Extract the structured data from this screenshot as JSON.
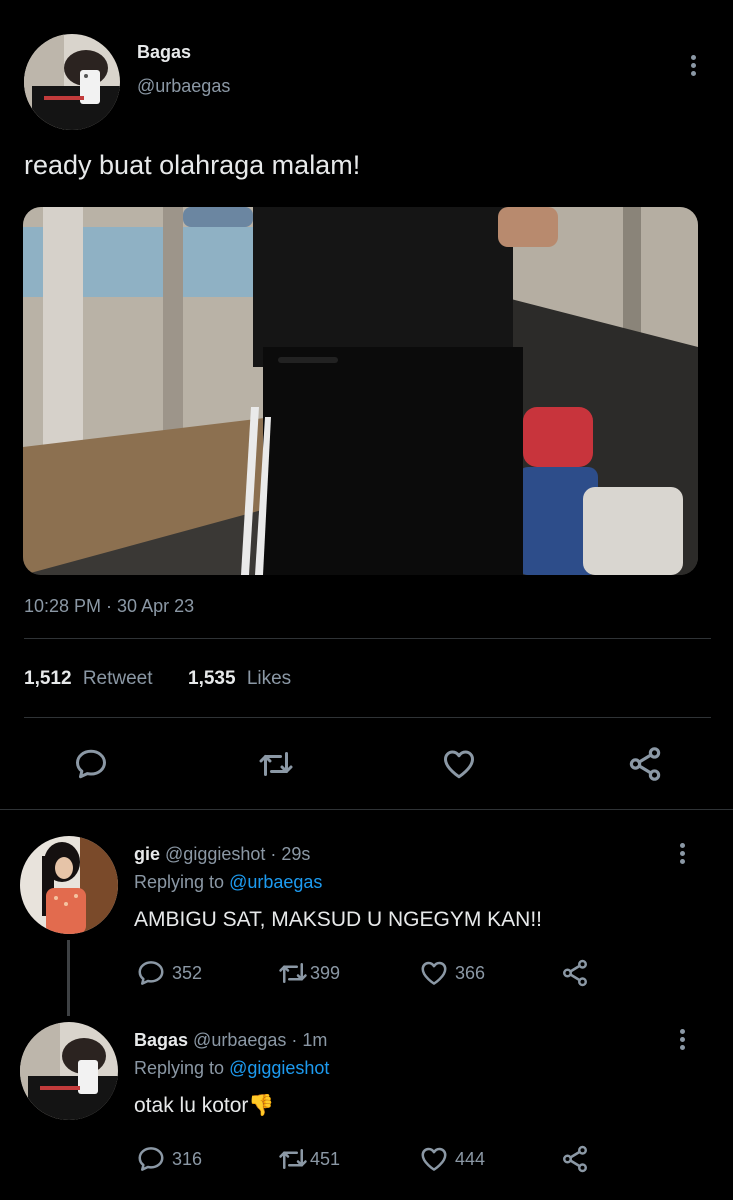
{
  "main_tweet": {
    "author_name": "Bagas",
    "author_handle": "@urbaegas",
    "text": "ready buat olahraga malam!",
    "timestamp": "10:28 PM · 30 Apr 23",
    "retweets_count": "1,512",
    "retweets_label": "Retweet",
    "likes_count": "1,535",
    "likes_label": "Likes",
    "actions": [
      "reply-icon",
      "retweet-icon",
      "like-icon",
      "share-icon"
    ]
  },
  "replies": [
    {
      "author_name": "gie",
      "author_handle": "@giggieshot",
      "time": " · 29s",
      "replying_prefix": "Replying to",
      "replying_to": "@urbaegas",
      "text": "AMBIGU SAT, MAKSUD U NGEGYM KAN!!",
      "reply_count": "352",
      "retweet_count": "399",
      "like_count": "366"
    },
    {
      "author_name": "Bagas",
      "author_handle": "@urbaegas",
      "time": " · 1m",
      "replying_prefix": "Replying to",
      "replying_to": "@giggieshot",
      "text": "otak lu kotor",
      "emoji": "👎",
      "reply_count": "316",
      "retweet_count": "451",
      "like_count": "444"
    }
  ]
}
